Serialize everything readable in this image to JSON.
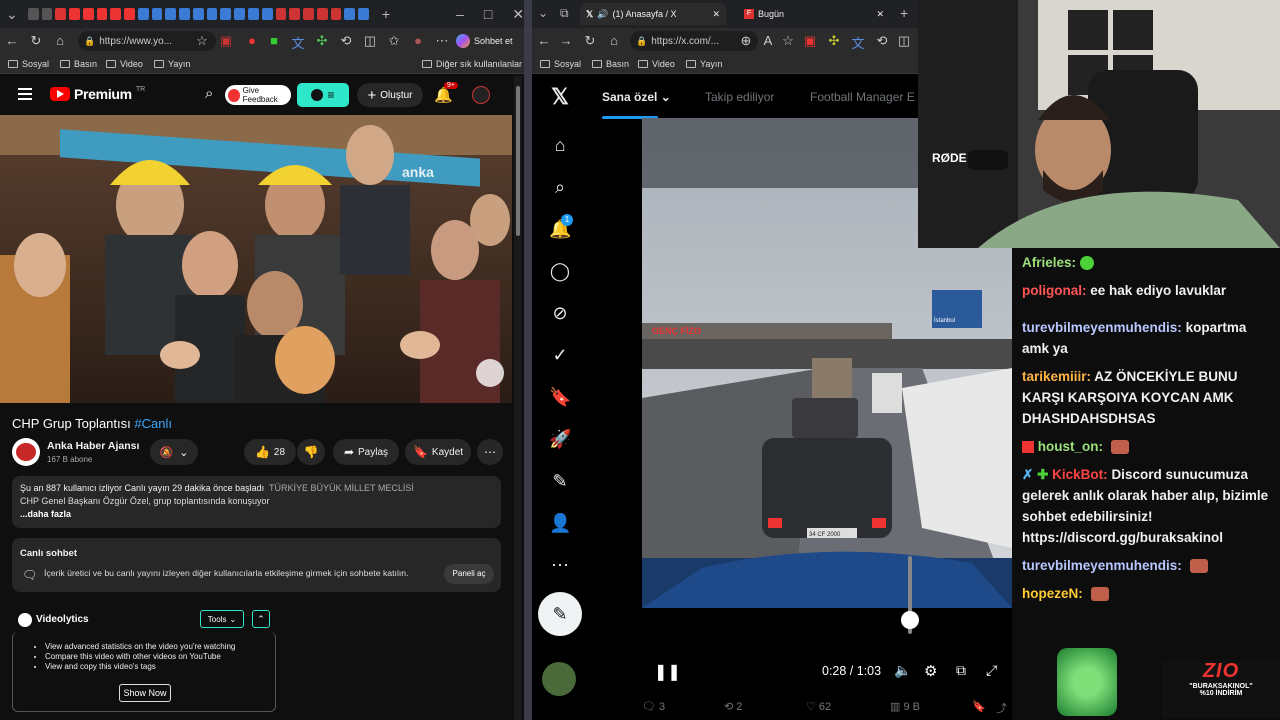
{
  "left_browser": {
    "url": "https://www.yo...",
    "chat_button": "Sohbet et",
    "bookmarks": [
      "Sosyal",
      "Basın",
      "Video",
      "Yayın"
    ],
    "other_bookmarks": "Diğer sık kullanılanlar"
  },
  "youtube": {
    "brand": "Premium",
    "brand_region": "TR",
    "feedback": "Give Feedback",
    "create": "Oluştur",
    "notif_count": "9+",
    "video_watermark": "anka",
    "title": "CHP Grup Toplantısı",
    "title_tag": "#Canlı",
    "channel": "Anka Haber Ajansı",
    "subscribers": "167 B abone",
    "likes": "28",
    "share": "Paylaş",
    "save": "Kaydet",
    "desc_line1_stats": "Şu an 887 kullanıcı izliyor  Canlı yayın 29 dakika önce başladı",
    "desc_line1_tag": "TÜRKİYE BÜYÜK MİLLET MECLİSİ",
    "desc_line2": "CHP Genel Başkanı Özgür Özel, grup toplantısında konuşuyor",
    "desc_more": "...daha fazla",
    "live_chat_title": "Canlı sohbet",
    "live_chat_text": "İçerik üretici ve bu canlı yayını izleyen diğer kullanıcılarla etkileşime girmek için sohbete katılın.",
    "live_chat_button": "Paneli aç",
    "videolytics": {
      "title": "Videolytics",
      "tools": "Tools",
      "items": [
        "View advanced statistics on the video you're watching",
        "Compare this video with other videos on YouTube",
        "View and copy this video's tags"
      ],
      "show_now": "Show Now"
    }
  },
  "right_browser": {
    "tab1": "(1) Anasayfa / X",
    "tab2": "Bugün",
    "url": "https://x.com/...",
    "bookmarks": [
      "Sosyal",
      "Basın",
      "Video",
      "Yayın"
    ]
  },
  "x": {
    "notif_count": "1",
    "tabs": [
      "Sana özel",
      "Takip ediliyor",
      "Football Manager E"
    ],
    "video_time": "0:28 / 1:03",
    "video_progress": 0.44,
    "stats": {
      "replies": "3",
      "reposts": "2",
      "likes": "62",
      "views": "9 B"
    },
    "video_sign": "İstanbul",
    "video_banner": "GENÇ FİZO",
    "video_plate": "34 CF 2000"
  },
  "chat": [
    {
      "user": "Afrieles:",
      "color": "#9be07a",
      "text": ""
    },
    {
      "user": "poligonal:",
      "color": "#ff5555",
      "text": "ee hak ediyo lavuklar"
    },
    {
      "user": "turevbilmeyenmuhendis:",
      "color": "#b7c7ff",
      "text": "kopartma amk ya"
    },
    {
      "user": "tarikemiiir:",
      "color": "#ffb347",
      "text": "AZ ÖNCEKİYLE BUNU KARŞI KARŞOIYA KOYCAN AMK DHASHDAHSDHSAS"
    },
    {
      "user": "houst_on:",
      "color": "#9be07a",
      "text": ""
    },
    {
      "user": "KickBot:",
      "color": "#ff4444",
      "text": "Discord sunucumuza gelerek anlık olarak haber alıp, bizimle sohbet edebilirsiniz! https://discord.gg/buraksakinol"
    },
    {
      "user": "turevbilmeyenmuhendis:",
      "color": "#b7c7ff",
      "text": ""
    },
    {
      "user": "hopezeN:",
      "color": "#ffcc33",
      "text": ""
    }
  ],
  "promo": {
    "brand": "ZIO",
    "code": "\"BURAKSAKINOL\"",
    "discount": "%10 İNDİRİM"
  },
  "colors": {
    "youtube_red": "#ff0000",
    "x_blue": "#1d9bf0",
    "feedback_cyan": "#2ee6c9"
  }
}
